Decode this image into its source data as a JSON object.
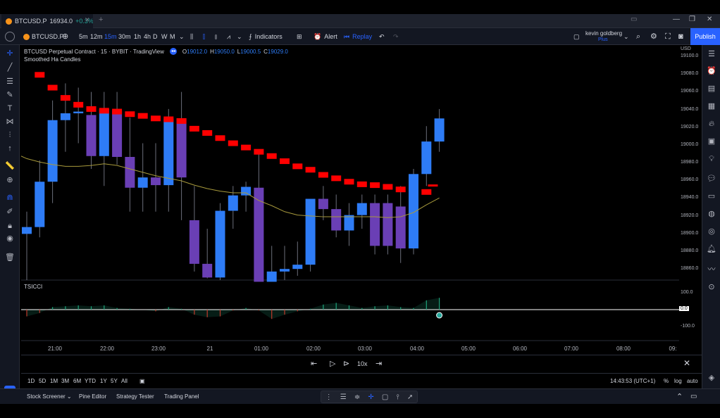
{
  "tab": {
    "title": "BTCUSD.P",
    "price": "16934.0",
    "change": "+0.3%"
  },
  "toolbar": {
    "symbol": "BTCUSD.P",
    "intervals": [
      "5m",
      "12m",
      "15m",
      "30m",
      "1h",
      "4h",
      "D",
      "W",
      "M"
    ],
    "active_interval": "15m",
    "indicators_label": "Indicators",
    "alert_label": "Alert",
    "replay_label": "Replay",
    "user_name": "kevin goldberg",
    "user_plan": "Plus",
    "publish_label": "Publish"
  },
  "legend": {
    "title": "BTCUSD Perpetual Contract · 15 · BYBIT · TradingView",
    "o_label": "O",
    "o_value": "19012.0",
    "h_label": "H",
    "h_value": "19050.0",
    "l_label": "L",
    "l_value": "19000.5",
    "c_label": "C",
    "c_value": "19029.0",
    "indicator": "Smoothed Ha Candles",
    "pane2_indicator": "TSICCI"
  },
  "axis": {
    "currency": "USD",
    "price_ticks": [
      "19100.0",
      "19080.0",
      "19060.0",
      "19040.0",
      "19020.0",
      "19000.0",
      "18980.0",
      "18960.0",
      "18940.0",
      "18920.0",
      "18900.0",
      "18880.0",
      "18860.0"
    ],
    "osc_ticks": [
      "100.0",
      "-100.0"
    ],
    "osc_zero": "0.0",
    "time_ticks": [
      "21:00",
      "22:00",
      "23:00",
      "21",
      "01:00",
      "02:00",
      "03:00",
      "04:00",
      "05:00",
      "06:00",
      "07:00",
      "08:00",
      "09:"
    ]
  },
  "colors": {
    "bull": "#2e7cf6",
    "bear": "#6a3fb5",
    "dot": "#ff0000",
    "ma": "#a89a3c",
    "osc_pos": "#1fa37a",
    "osc_neg": "#c0392b"
  },
  "chart_data": {
    "type": "candlestick",
    "ylim": [
      18850,
      19110
    ],
    "candles": [
      {
        "o": 18904,
        "h": 18930,
        "l": 18850,
        "c": 18912,
        "dir": "up",
        "dot": null
      },
      {
        "o": 18912,
        "h": 18990,
        "l": 18900,
        "c": 18965,
        "dir": "up",
        "dot": 19090
      },
      {
        "o": 18965,
        "h": 19060,
        "l": 18940,
        "c": 19037,
        "dir": "up",
        "dot": 19075
      },
      {
        "o": 19037,
        "h": 19080,
        "l": 19000,
        "c": 19045,
        "dir": "up",
        "dot": 19063
      },
      {
        "o": 19045,
        "h": 19075,
        "l": 19010,
        "c": 19047,
        "dir": "up",
        "dot": 19055
      },
      {
        "o": 19043,
        "h": 19070,
        "l": 18980,
        "c": 18995,
        "dir": "down",
        "dot": 19050
      },
      {
        "o": 18995,
        "h": 19070,
        "l": 18960,
        "c": 19050,
        "dir": "up",
        "dot": 19048
      },
      {
        "o": 19048,
        "h": 19070,
        "l": 18985,
        "c": 18994,
        "dir": "down",
        "dot": 19047
      },
      {
        "o": 18994,
        "h": 19040,
        "l": 18930,
        "c": 18958,
        "dir": "down",
        "dot": 19044
      },
      {
        "o": 18958,
        "h": 19010,
        "l": 18930,
        "c": 18970,
        "dir": "up",
        "dot": 19042
      },
      {
        "o": 18970,
        "h": 19010,
        "l": 18930,
        "c": 18961,
        "dir": "down",
        "dot": 19039
      },
      {
        "o": 18961,
        "h": 19050,
        "l": 18930,
        "c": 19039,
        "dir": "up",
        "dot": 19038
      },
      {
        "o": 19039,
        "h": 19070,
        "l": 18920,
        "c": 18970,
        "dir": "down",
        "dot": 19036
      },
      {
        "o": 18920,
        "h": 18960,
        "l": 18860,
        "c": 18869,
        "dir": "down",
        "dot": 19027
      },
      {
        "o": 18869,
        "h": 18910,
        "l": 18852,
        "c": 18853,
        "dir": "down",
        "dot": 19022
      },
      {
        "o": 18853,
        "h": 18940,
        "l": 18850,
        "c": 18931,
        "dir": "up",
        "dot": 19016
      },
      {
        "o": 18931,
        "h": 18960,
        "l": 18910,
        "c": 18949,
        "dir": "up",
        "dot": 19010
      },
      {
        "o": 18949,
        "h": 18965,
        "l": 18930,
        "c": 18959,
        "dir": "up",
        "dot": 19005
      },
      {
        "o": 18958,
        "h": 19000,
        "l": 18840,
        "c": 18848,
        "dir": "down",
        "dot": 19000
      },
      {
        "o": 18848,
        "h": 18890,
        "l": 18840,
        "c": 18860,
        "dir": "up",
        "dot": 18995
      },
      {
        "o": 18860,
        "h": 18890,
        "l": 18850,
        "c": 18863,
        "dir": "up",
        "dot": 18989
      },
      {
        "o": 18863,
        "h": 18895,
        "l": 18855,
        "c": 18868,
        "dir": "up",
        "dot": 18983
      },
      {
        "o": 18868,
        "h": 18940,
        "l": 18860,
        "c": 18945,
        "dir": "up",
        "dot": 18979
      },
      {
        "o": 18945,
        "h": 18960,
        "l": 18920,
        "c": 18933,
        "dir": "down",
        "dot": 18973
      },
      {
        "o": 18933,
        "h": 18950,
        "l": 18900,
        "c": 18908,
        "dir": "down",
        "dot": 18969
      },
      {
        "o": 18908,
        "h": 18940,
        "l": 18890,
        "c": 18926,
        "dir": "up",
        "dot": 18965
      },
      {
        "o": 18926,
        "h": 18950,
        "l": 18910,
        "c": 18940,
        "dir": "up",
        "dot": 18962
      },
      {
        "o": 18940,
        "h": 18950,
        "l": 18880,
        "c": 18890,
        "dir": "down",
        "dot": 18961
      },
      {
        "o": 18940,
        "h": 18950,
        "l": 18880,
        "c": 18890,
        "dir": "down",
        "dot": 18959
      },
      {
        "o": 18936,
        "h": 18960,
        "l": 18870,
        "c": 18887,
        "dir": "down",
        "dot": 18956
      },
      {
        "o": 18887,
        "h": 18980,
        "l": 18880,
        "c": 18974,
        "dir": "up",
        "dot": null
      },
      {
        "o": 18974,
        "h": 19030,
        "l": 18960,
        "c": 19012,
        "dir": "up",
        "dot": 18953
      },
      {
        "o": 19012,
        "h": 19050,
        "l": 19000,
        "c": 19039,
        "dir": "up",
        "dot": null
      }
    ],
    "ma": [
      18992,
      18988,
      18985,
      18983,
      18983,
      18984,
      18986,
      18984,
      18980,
      18976,
      18972,
      18969,
      18966,
      18961,
      18957,
      18954,
      18952,
      18952,
      18943,
      18937,
      18930,
      18926,
      18925,
      18924,
      18924,
      18924,
      18924,
      18924,
      18923,
      18924,
      18929,
      18938,
      18946
    ],
    "osc": [
      -40,
      -20,
      15,
      20,
      25,
      20,
      25,
      10,
      5,
      0,
      -10,
      15,
      5,
      -30,
      -45,
      -40,
      -5,
      10,
      -5,
      -55,
      -30,
      -10,
      5,
      30,
      40,
      25,
      10,
      20,
      25,
      15,
      10,
      55,
      70
    ]
  },
  "replay": {
    "speed": "10x"
  },
  "range": {
    "buttons": [
      "1D",
      "5D",
      "1M",
      "3M",
      "6M",
      "YTD",
      "1Y",
      "5Y",
      "All"
    ],
    "time": "14:43:53 (UTC+1)",
    "pct": "%",
    "log": "log",
    "auto": "auto"
  },
  "bottom": {
    "items": [
      "Stock Screener",
      "Pine Editor",
      "Strategy Tester",
      "Trading Panel"
    ]
  }
}
